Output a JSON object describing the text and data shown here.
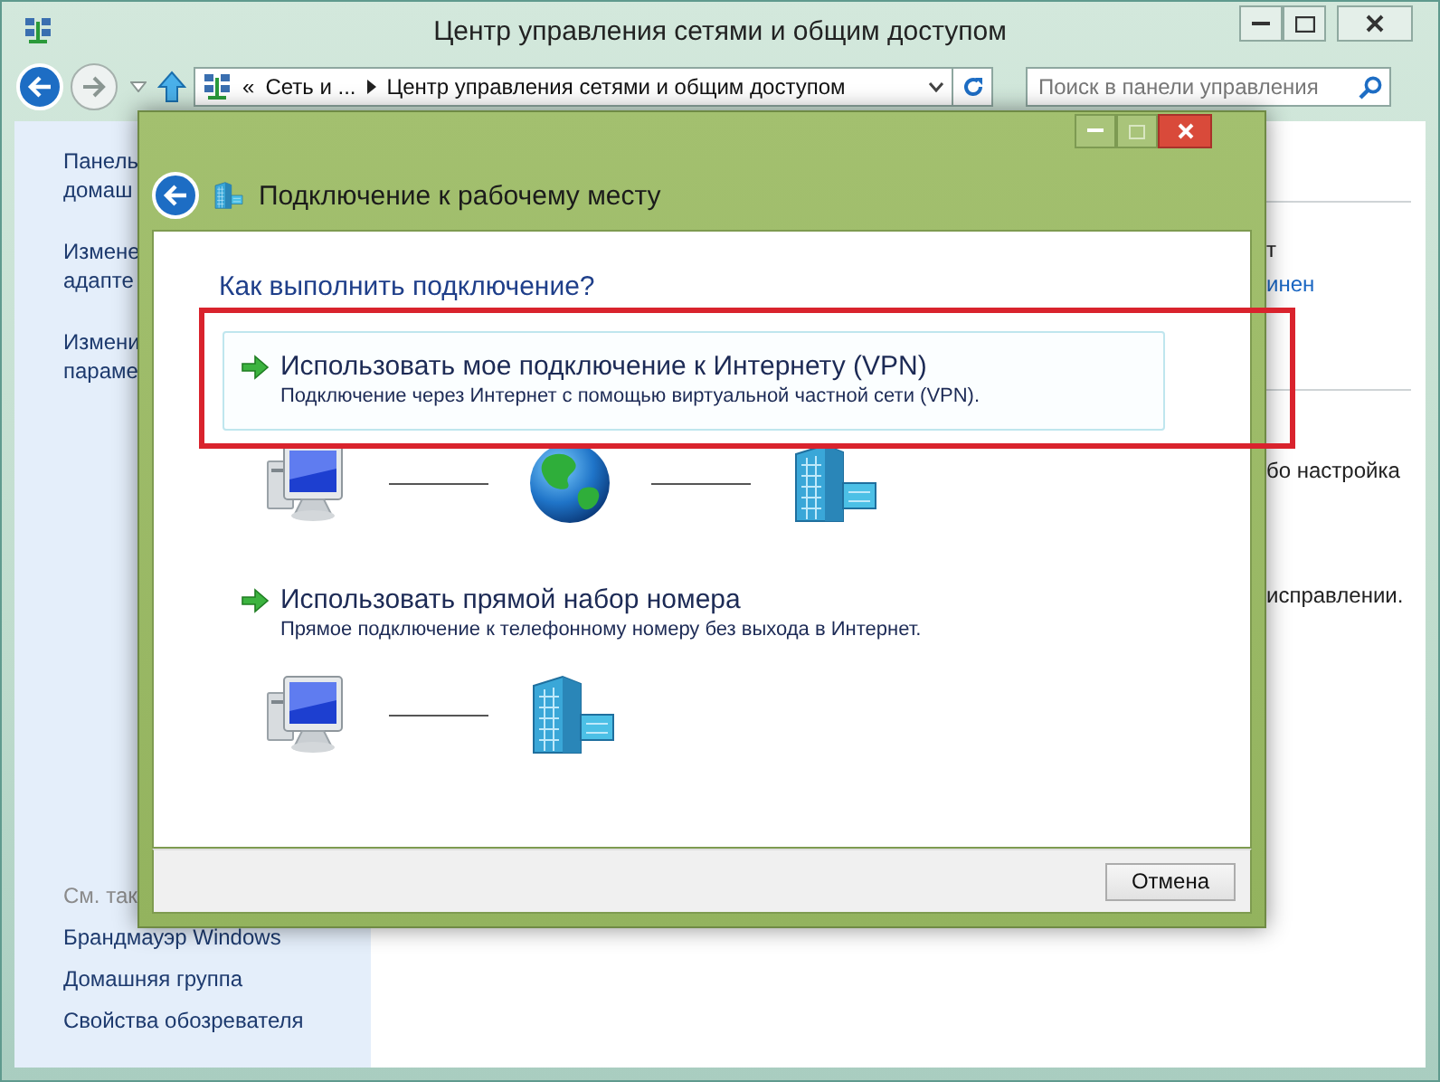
{
  "window": {
    "title": "Центр управления сетями и общим доступом"
  },
  "address_bar": {
    "overflow": "«",
    "crumbs": [
      {
        "label": "Сеть и ..."
      },
      {
        "label": "Центр управления сетями и общим доступом"
      }
    ]
  },
  "search": {
    "placeholder": "Поиск в панели управления"
  },
  "sidebar": {
    "links": [
      {
        "lines": [
          "Панель",
          "домаш"
        ]
      },
      {
        "lines": [
          "Измене",
          "адапте"
        ]
      },
      {
        "lines": [
          "Измени",
          "параме"
        ]
      }
    ],
    "see_also": {
      "heading": "См. так",
      "links": [
        "Брандмауэр Windows",
        "Домашняя группа",
        "Свойства обозревателя"
      ]
    }
  },
  "main": {
    "sections": [
      {
        "items": [
          {
            "kind": "text",
            "text": "т"
          },
          {
            "kind": "link",
            "text": "инен"
          }
        ]
      },
      {
        "items": [
          {
            "kind": "text",
            "text": "бо настройка"
          },
          {
            "kind": "text",
            "text": "исправлении."
          }
        ]
      }
    ]
  },
  "dialog": {
    "title": "Подключение к рабочему месту",
    "heading": "Как выполнить подключение?",
    "options": [
      {
        "title": "Использовать мое подключение к Интернету (VPN)",
        "description": "Подключение через Интернет с помощью виртуальной частной сети (VPN).",
        "highlighted": true,
        "diagram": [
          {
            "kind": "computer"
          },
          {
            "kind": "globe"
          },
          {
            "kind": "building"
          }
        ]
      },
      {
        "title": "Использовать прямой набор номера",
        "description": "Прямое подключение к телефонному номеру без выхода в Интернет.",
        "highlighted": false,
        "diagram": [
          {
            "kind": "computer"
          },
          {
            "kind": "building"
          }
        ]
      }
    ],
    "cancel": "Отмена"
  }
}
